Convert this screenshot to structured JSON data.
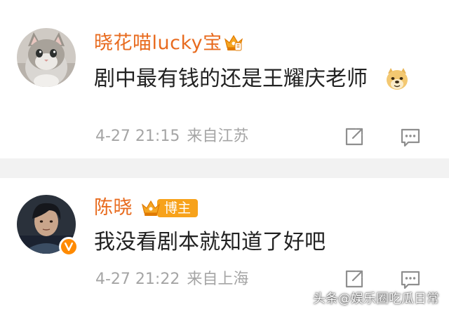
{
  "comments": [
    {
      "username": "晓花喵lucky宝",
      "text": "剧中最有钱的还是王耀庆老师",
      "timestamp": "4-27 21:15",
      "location": "来自江苏",
      "avatar": "kitten-avatar",
      "badge": "crown-icon",
      "emoji": "doge-emoji"
    },
    {
      "username": "陈晓",
      "tag": "博主",
      "text": "我没看剧本就知道了好吧",
      "timestamp": "4-27 21:22",
      "location": "来自上海",
      "avatar": "person-avatar",
      "badge": "crown-icon"
    }
  ],
  "watermark": "头条@娱乐圈吃瓜日常",
  "colors": {
    "username": "#e86b1f",
    "text": "#222222",
    "meta": "#a5a5a5",
    "separator": "#f2f2f2",
    "tag_bg": "#f7a21b",
    "verify": "#ff8a00"
  }
}
